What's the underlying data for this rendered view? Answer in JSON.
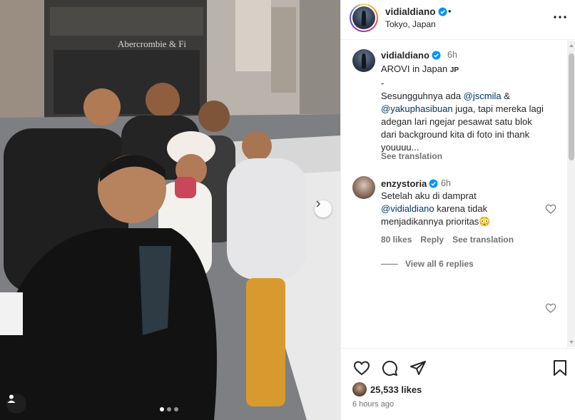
{
  "header": {
    "username": "vidialdiano",
    "separator": "•",
    "location": "Tokyo, Japan"
  },
  "photo": {
    "storefront_sign": "Abercrombie & Fi",
    "carousel_total": 3,
    "carousel_active": 1
  },
  "caption": {
    "username": "vidialdiano",
    "time": "6h",
    "line1": "AROVI in Japan",
    "line1_tag": "JP",
    "line2": "-",
    "line3_pre": "Sesungguhnya ada ",
    "mention1": "@jscmila",
    "line3_post": " &",
    "mention2": "@yakuphasibuan",
    "line4_post": " juga, tapi mereka lagi",
    "line5": "adegan lari ngejar pesawat satu blok",
    "line6": "dari background kita di foto ini thank",
    "line7": "youuuu...",
    "see_translation": "See translation"
  },
  "comment": {
    "username": "enzystoria",
    "time": "6h",
    "line1": "Setelah aku di damprat",
    "mention": "@vidialdiano",
    "line2_post": " karena tidak",
    "line3": "menjadikannya prioritas😳",
    "likes": "80 likes",
    "reply": "Reply",
    "see_translation": "See translation",
    "view_replies": "View all 6 replies"
  },
  "footer": {
    "likes_count": "25,533 likes",
    "time_ago": "6 hours ago"
  },
  "colors": {
    "verified": "#0095f6",
    "mention": "#00376b",
    "muted": "#737373"
  }
}
